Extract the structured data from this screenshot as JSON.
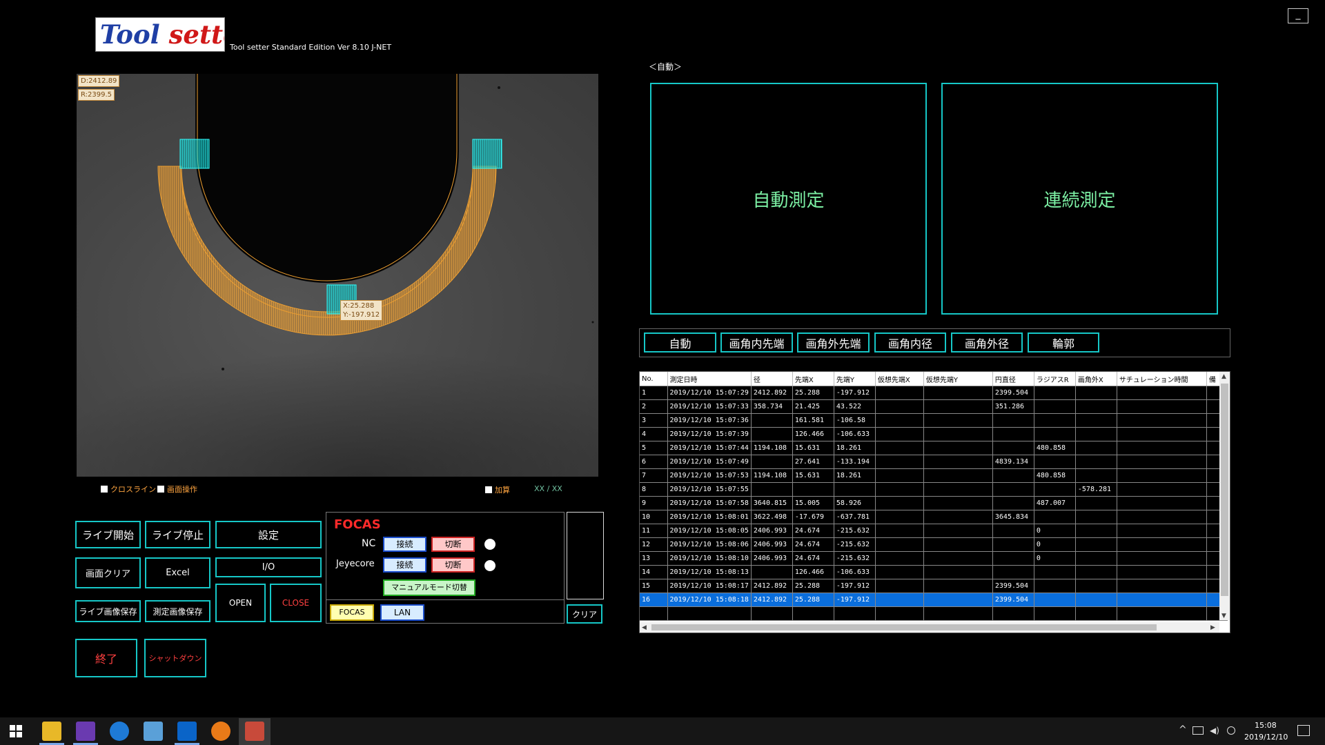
{
  "app": {
    "logo_text_1": "Tool ",
    "logo_text_2": "setter",
    "version": "Tool setter Standard Edition Ver 8.10 J-NET",
    "minimize_glyph": "_"
  },
  "camera": {
    "diameter_label": "D:2412.89",
    "radius_label": "R:2399.5",
    "tip_x_label": "X:25.288",
    "tip_y_label": "Y:-197.912",
    "crossline_label": "クロスライン",
    "screen_op_label": "画面操作",
    "add_label": "加算",
    "xx_readout": "XX  /  XX"
  },
  "controls": {
    "live_start": "ライブ開始",
    "live_stop": "ライブ停止",
    "settings": "設定",
    "screen_clear": "画面クリア",
    "excel": "Excel",
    "io": "I/O",
    "open": "OPEN",
    "close": "CLOSE",
    "save_live_image": "ライブ画像保存",
    "save_meas_image": "測定画像保存",
    "exit": "終了",
    "shutdown": "シャットダウン",
    "clear": "クリア"
  },
  "focas": {
    "title": "FOCAS",
    "nc_label": "NC",
    "jeyecore_label": "Jeyecore",
    "connect": "接続",
    "disconnect": "切断",
    "manual_mode": "マニュアルモード切替",
    "focas_button": "FOCAS",
    "lan_button": "LAN"
  },
  "measure": {
    "mode_label": "＜自動＞",
    "auto_measure": "自動測定",
    "continuous_measure": "連続測定",
    "tabs": [
      "自動",
      "画角内先端",
      "画角外先端",
      "画角内径",
      "画角外径",
      "輪郭"
    ]
  },
  "results": {
    "columns": [
      "No.",
      "測定日時",
      "径",
      "先端X",
      "先端Y",
      "仮想先端X",
      "仮想先端Y",
      "円直径",
      "ラジアスR",
      "画角外X",
      "サチュレーション時間",
      "備"
    ],
    "rows": [
      [
        "1",
        "2019/12/10 15:07:29",
        "2412.892",
        "25.288",
        "-197.912",
        "",
        "",
        "2399.504",
        "",
        "",
        "",
        ""
      ],
      [
        "2",
        "2019/12/10 15:07:33",
        "358.734",
        "21.425",
        "43.522",
        "",
        "",
        "351.286",
        "",
        "",
        "",
        ""
      ],
      [
        "3",
        "2019/12/10 15:07:36",
        "",
        "161.581",
        "-106.58",
        "",
        "",
        "",
        "",
        "",
        "",
        ""
      ],
      [
        "4",
        "2019/12/10 15:07:39",
        "",
        "126.466",
        "-106.633",
        "",
        "",
        "",
        "",
        "",
        "",
        ""
      ],
      [
        "5",
        "2019/12/10 15:07:44",
        "1194.108",
        "15.631",
        "18.261",
        "",
        "",
        "",
        "480.858",
        "",
        "",
        ""
      ],
      [
        "6",
        "2019/12/10 15:07:49",
        "",
        "27.641",
        "-133.194",
        "",
        "",
        "4839.134",
        "",
        "",
        "",
        ""
      ],
      [
        "7",
        "2019/12/10 15:07:53",
        "1194.108",
        "15.631",
        "18.261",
        "",
        "",
        "",
        "480.858",
        "",
        "",
        ""
      ],
      [
        "8",
        "2019/12/10 15:07:55",
        "",
        "",
        "",
        "",
        "",
        "",
        "",
        "-578.281",
        "",
        ""
      ],
      [
        "9",
        "2019/12/10 15:07:58",
        "3640.815",
        "15.005",
        "58.926",
        "",
        "",
        "",
        "487.007",
        "",
        "",
        ""
      ],
      [
        "10",
        "2019/12/10 15:08:01",
        "3622.498",
        "-17.679",
        "-637.781",
        "",
        "",
        "3645.834",
        "",
        "",
        "",
        ""
      ],
      [
        "11",
        "2019/12/10 15:08:05",
        "2406.993",
        "24.674",
        "-215.632",
        "",
        "",
        "",
        "0",
        "",
        "",
        ""
      ],
      [
        "12",
        "2019/12/10 15:08:06",
        "2406.993",
        "24.674",
        "-215.632",
        "",
        "",
        "",
        "0",
        "",
        "",
        ""
      ],
      [
        "13",
        "2019/12/10 15:08:10",
        "2406.993",
        "24.674",
        "-215.632",
        "",
        "",
        "",
        "0",
        "",
        "",
        ""
      ],
      [
        "14",
        "2019/12/10 15:08:13",
        "",
        "126.466",
        "-106.633",
        "",
        "",
        "",
        "",
        "",
        "",
        ""
      ],
      [
        "15",
        "2019/12/10 15:08:17",
        "2412.892",
        "25.288",
        "-197.912",
        "",
        "",
        "2399.504",
        "",
        "",
        "",
        ""
      ],
      [
        "16",
        "2019/12/10 15:08:18",
        "2412.892",
        "25.288",
        "-197.912",
        "",
        "",
        "2399.504",
        "",
        "",
        "",
        ""
      ]
    ],
    "selected_row": 16
  },
  "taskbar": {
    "icons": [
      "windows-start-icon",
      "file-explorer-icon",
      "visual-studio-icon",
      "internet-explorer-icon",
      "network-app-icon",
      "outlook-icon",
      "ha-app-icon",
      "toolsetter-app-icon"
    ],
    "time": "15:08",
    "date": "2019/12/10"
  },
  "colors": {
    "accent_cyan": "#16c8c8",
    "overlay_orange": "#f0a030",
    "green_text": "#7cf0a4",
    "selection_blue": "#0a6edc",
    "focas_red": "#ff2a2a"
  }
}
